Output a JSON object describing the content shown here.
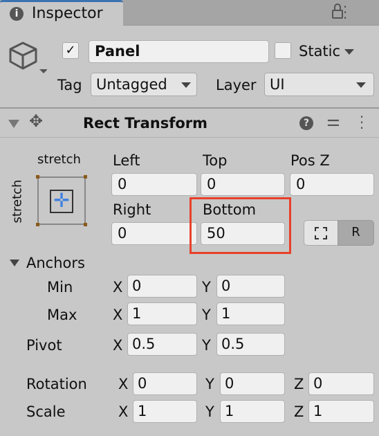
{
  "tab": {
    "title": "Inspector",
    "icon": "info-icon"
  },
  "object": {
    "active": true,
    "name": "Panel",
    "static_label": "Static",
    "static": false,
    "tag_label": "Tag",
    "tag": "Untagged",
    "layer_label": "Layer",
    "layer": "UI"
  },
  "component": {
    "title": "Rect Transform"
  },
  "rect": {
    "anchor_h": "stretch",
    "anchor_v": "stretch",
    "left_label": "Left",
    "left": "0",
    "top_label": "Top",
    "top": "0",
    "posz_label": "Pos Z",
    "posz": "0",
    "right_label": "Right",
    "right": "0",
    "bottom_label": "Bottom",
    "bottom": "50",
    "raw_button": "R",
    "highlight_color": "#e8402a"
  },
  "anchors": {
    "label": "Anchors",
    "min_label": "Min",
    "min_x": "0",
    "min_y": "0",
    "max_label": "Max",
    "max_x": "1",
    "max_y": "1"
  },
  "pivot": {
    "label": "Pivot",
    "x": "0.5",
    "y": "0.5"
  },
  "rotation": {
    "label": "Rotation",
    "x": "0",
    "y": "0",
    "z": "0"
  },
  "scale": {
    "label": "Scale",
    "x": "1",
    "y": "1",
    "z": "1"
  },
  "axes": {
    "x": "X",
    "y": "Y",
    "z": "Z"
  }
}
